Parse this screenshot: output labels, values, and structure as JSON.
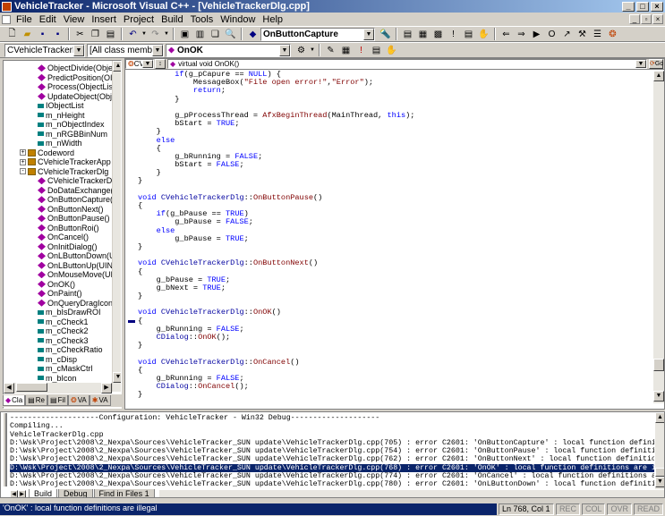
{
  "window": {
    "title": "VehicleTracker - Microsoft Visual C++ - [VehicleTrackerDlg.cpp]",
    "min_glyph": "_",
    "max_glyph": "□",
    "close_glyph": "×"
  },
  "menu": {
    "items": [
      "File",
      "Edit",
      "View",
      "Insert",
      "Project",
      "Build",
      "Tools",
      "Window",
      "Help"
    ],
    "mdi_buttons": [
      "_",
      "▫",
      "×"
    ]
  },
  "toolbar1": {
    "function_combo": "OnButtonCapture"
  },
  "toolbar2": {
    "class_combo": "CVehicleTrackerDlg",
    "filter_combo": "[All class members]",
    "member_combo": "OnOK"
  },
  "classview": {
    "tree": [
      {
        "label": "ObjectDivide(Obje",
        "icon": "method",
        "indent": 3
      },
      {
        "label": "PredictPosition(OI",
        "icon": "method",
        "indent": 3
      },
      {
        "label": "Process(ObjectLis",
        "icon": "method",
        "indent": 3
      },
      {
        "label": "UpdateObject(Obje",
        "icon": "method",
        "indent": 3
      },
      {
        "label": "IObjectList",
        "icon": "member",
        "indent": 3
      },
      {
        "label": "m_nHeight",
        "icon": "member",
        "indent": 3
      },
      {
        "label": "m_nObjectIndex",
        "icon": "member",
        "indent": 3
      },
      {
        "label": "m_nRGBBinNum",
        "icon": "member",
        "indent": 3
      },
      {
        "label": "m_nWidth",
        "icon": "member",
        "indent": 3
      },
      {
        "label": "Codeword",
        "icon": "cls",
        "indent": 1,
        "expander": "+"
      },
      {
        "label": "CVehicleTrackerApp",
        "icon": "cls",
        "indent": 1,
        "expander": "+"
      },
      {
        "label": "CVehicleTrackerDlg",
        "icon": "cls",
        "indent": 1,
        "expander": "-"
      },
      {
        "label": "CVehicleTrackerD",
        "icon": "method",
        "indent": 3
      },
      {
        "label": "DoDataExchange(",
        "icon": "method",
        "indent": 3
      },
      {
        "label": "OnButtonCapture(",
        "icon": "method",
        "indent": 3
      },
      {
        "label": "OnButtonNext()",
        "icon": "method",
        "indent": 3
      },
      {
        "label": "OnButtonPause()",
        "icon": "method",
        "indent": 3
      },
      {
        "label": "OnButtonRoi()",
        "icon": "method",
        "indent": 3
      },
      {
        "label": "OnCancel()",
        "icon": "method",
        "indent": 3
      },
      {
        "label": "OnInitDialog()",
        "icon": "method",
        "indent": 3
      },
      {
        "label": "OnLButtonDown(U",
        "icon": "method",
        "indent": 3
      },
      {
        "label": "OnLButtonUp(UIN",
        "icon": "method",
        "indent": 3
      },
      {
        "label": "OnMouseMove(UI",
        "icon": "method",
        "indent": 3
      },
      {
        "label": "OnOK()",
        "icon": "method",
        "indent": 3
      },
      {
        "label": "OnPaint()",
        "icon": "method",
        "indent": 3
      },
      {
        "label": "OnQueryDragIcon",
        "icon": "method",
        "indent": 3
      },
      {
        "label": "m_bIsDrawROI",
        "icon": "member",
        "indent": 3
      },
      {
        "label": "m_cCheck1",
        "icon": "member",
        "indent": 3
      },
      {
        "label": "m_cCheck2",
        "icon": "member",
        "indent": 3
      },
      {
        "label": "m_cCheck3",
        "icon": "member",
        "indent": 3
      },
      {
        "label": "m_cCheckRatio",
        "icon": "member",
        "indent": 3
      },
      {
        "label": "m_cDisp",
        "icon": "member",
        "indent": 3
      },
      {
        "label": "m_cMaskCtrl",
        "icon": "member",
        "indent": 3
      },
      {
        "label": "m_bIcon",
        "icon": "member",
        "indent": 3
      }
    ],
    "tabs": [
      "Cla",
      "Re",
      "Fil",
      "VA",
      "VA"
    ]
  },
  "editor": {
    "nav_class": "CV",
    "nav_function": "virtual void OnOK()",
    "go_label": "Go",
    "code_lines": [
      [
        [
          "        ",
          ""
        ],
        [
          "if",
          "kw"
        ],
        [
          "(g_pCapure == ",
          ""
        ],
        [
          "NULL",
          "kw"
        ],
        [
          ") {",
          ""
        ]
      ],
      [
        [
          "            MessageBox(",
          ""
        ],
        [
          "\"File open error!\"",
          "str"
        ],
        [
          ",",
          ""
        ],
        [
          "\"Error\"",
          "str"
        ],
        [
          ");",
          ""
        ]
      ],
      [
        [
          "            ",
          ""
        ],
        [
          "return",
          "kw"
        ],
        [
          ";",
          ""
        ]
      ],
      [
        [
          "        }",
          ""
        ]
      ],
      [
        [
          "",
          ""
        ]
      ],
      [
        [
          "        g_pProcessThread = ",
          ""
        ],
        [
          "AfxBeginThread",
          "fn"
        ],
        [
          "(MainThread, ",
          ""
        ],
        [
          "this",
          "kw"
        ],
        [
          ");",
          ""
        ]
      ],
      [
        [
          "        bStart = ",
          ""
        ],
        [
          "TRUE",
          "kw"
        ],
        [
          ";",
          ""
        ]
      ],
      [
        [
          "    }",
          ""
        ]
      ],
      [
        [
          "    ",
          ""
        ],
        [
          "else",
          "kw"
        ]
      ],
      [
        [
          "    {",
          ""
        ]
      ],
      [
        [
          "        g_bRunning = ",
          ""
        ],
        [
          "FALSE",
          "kw"
        ],
        [
          ";",
          ""
        ]
      ],
      [
        [
          "        bStart = ",
          ""
        ],
        [
          "FALSE",
          "kw"
        ],
        [
          ";",
          ""
        ]
      ],
      [
        [
          "    }",
          ""
        ]
      ],
      [
        [
          "}",
          ""
        ]
      ],
      [
        [
          "",
          ""
        ]
      ],
      [
        [
          "void",
          "kw"
        ],
        [
          " ",
          ""
        ],
        [
          "CVehicleTrackerDlg",
          "typ"
        ],
        [
          "::",
          ""
        ],
        [
          "OnButtonPause",
          "fn"
        ],
        [
          "()",
          ""
        ]
      ],
      [
        [
          "{",
          ""
        ]
      ],
      [
        [
          "    ",
          ""
        ],
        [
          "if",
          "kw"
        ],
        [
          "(g_bPause == ",
          ""
        ],
        [
          "TRUE",
          "kw"
        ],
        [
          ")",
          ""
        ]
      ],
      [
        [
          "        g_bPause = ",
          ""
        ],
        [
          "FALSE",
          "kw"
        ],
        [
          ";",
          ""
        ]
      ],
      [
        [
          "    ",
          ""
        ],
        [
          "else",
          "kw"
        ]
      ],
      [
        [
          "        g_bPause = ",
          ""
        ],
        [
          "TRUE",
          "kw"
        ],
        [
          ";",
          ""
        ]
      ],
      [
        [
          "}",
          ""
        ]
      ],
      [
        [
          "",
          ""
        ]
      ],
      [
        [
          "void",
          "kw"
        ],
        [
          " ",
          ""
        ],
        [
          "CVehicleTrackerDlg",
          "typ"
        ],
        [
          "::",
          ""
        ],
        [
          "OnButtonNext",
          "fn"
        ],
        [
          "()",
          ""
        ]
      ],
      [
        [
          "{",
          ""
        ]
      ],
      [
        [
          "    g_bPause = ",
          ""
        ],
        [
          "TRUE",
          "kw"
        ],
        [
          ";",
          ""
        ]
      ],
      [
        [
          "    g_bNext = ",
          ""
        ],
        [
          "TRUE",
          "kw"
        ],
        [
          ";",
          ""
        ]
      ],
      [
        [
          "}",
          ""
        ]
      ],
      [
        [
          "",
          ""
        ]
      ],
      [
        [
          "void",
          "kw"
        ],
        [
          " ",
          ""
        ],
        [
          "CVehicleTrackerDlg",
          "typ"
        ],
        [
          "::",
          ""
        ],
        [
          "OnOK",
          "fn"
        ],
        [
          "()",
          ""
        ]
      ],
      [
        [
          "{",
          ""
        ]
      ],
      [
        [
          "    g_bRunning = ",
          ""
        ],
        [
          "FALSE",
          "kw"
        ],
        [
          ";",
          ""
        ]
      ],
      [
        [
          "    ",
          ""
        ],
        [
          "CDialog",
          "typ"
        ],
        [
          "::",
          ""
        ],
        [
          "OnOK",
          "fn"
        ],
        [
          "();",
          ""
        ]
      ],
      [
        [
          "}",
          ""
        ]
      ],
      [
        [
          "",
          ""
        ]
      ],
      [
        [
          "void",
          "kw"
        ],
        [
          " ",
          ""
        ],
        [
          "CVehicleTrackerDlg",
          "typ"
        ],
        [
          "::",
          ""
        ],
        [
          "OnCancel",
          "fn"
        ],
        [
          "()",
          ""
        ]
      ],
      [
        [
          "{",
          ""
        ]
      ],
      [
        [
          "    g_bRunning = ",
          ""
        ],
        [
          "FALSE",
          "kw"
        ],
        [
          ";",
          ""
        ]
      ],
      [
        [
          "    ",
          ""
        ],
        [
          "CDialog",
          "typ"
        ],
        [
          "::",
          ""
        ],
        [
          "OnCancel",
          "fn"
        ],
        [
          "();",
          ""
        ]
      ],
      [
        [
          "}",
          ""
        ]
      ]
    ],
    "marker_line_index": 30
  },
  "output": {
    "lines": [
      {
        "text": "--------------------Configuration: VehicleTracker - Win32 Debug--------------------",
        "hl": false
      },
      {
        "text": "Compiling...",
        "hl": false
      },
      {
        "text": "VehicleTrackerDlg.cpp",
        "hl": false
      },
      {
        "text": "D:\\Wsk\\Project\\2008\\2_Nexpa\\Sources\\VehicleTracker_SUN update\\VehicleTrackerDlg.cpp(705) : error C2601: 'OnButtonCapture' : local function definitions are illegal",
        "hl": false
      },
      {
        "text": "D:\\Wsk\\Project\\2008\\2_Nexpa\\Sources\\VehicleTracker_SUN update\\VehicleTrackerDlg.cpp(754) : error C2601: 'OnButtonPause' : local function definitions are il",
        "hl": false
      },
      {
        "text": "D:\\Wsk\\Project\\2008\\2_Nexpa\\Sources\\VehicleTracker_SUN update\\VehicleTrackerDlg.cpp(762) : error C2601: 'OnButtonNext' : local function definitions are il",
        "hl": false
      },
      {
        "text": "D:\\Wsk\\Project\\2008\\2_Nexpa\\Sources\\VehicleTracker_SUN update\\VehicleTrackerDlg.cpp(768) : error C2601: 'OnOK' : local function definitions are illegal",
        "hl": true
      },
      {
        "text": "D:\\Wsk\\Project\\2008\\2_Nexpa\\Sources\\VehicleTracker_SUN update\\VehicleTrackerDlg.cpp(774) : error C2601: 'OnCancel' : local function definitions are illega",
        "hl": false
      },
      {
        "text": "D:\\Wsk\\Project\\2008\\2_Nexpa\\Sources\\VehicleTracker_SUN update\\VehicleTrackerDlg.cpp(780) : error C2601: 'OnLButtonDown' : local function definitions are i",
        "hl": false
      }
    ],
    "tabs": [
      "Build",
      "Debug",
      "Find in Files 1"
    ]
  },
  "status": {
    "message": "'OnOK' : local function definitions are illegal",
    "position": "Ln 768, Col 1",
    "indicators": [
      "REC",
      "COL",
      "OVR",
      "READ"
    ]
  }
}
